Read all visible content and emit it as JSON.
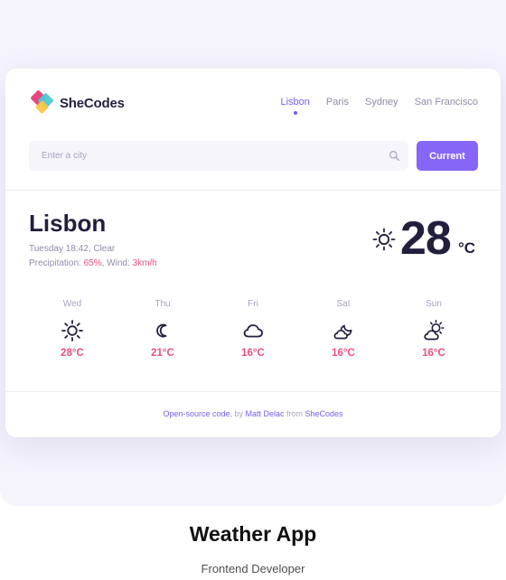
{
  "brand": {
    "name": "SheCodes"
  },
  "nav": {
    "items": [
      {
        "label": "Lisbon",
        "active": true
      },
      {
        "label": "Paris",
        "active": false
      },
      {
        "label": "Sydney",
        "active": false
      },
      {
        "label": "San Francisco",
        "active": false
      }
    ]
  },
  "search": {
    "placeholder": "Enter a city",
    "value": "",
    "icon": "search-icon",
    "button_label": "Current"
  },
  "current": {
    "city": "Lisbon",
    "day_time": "Tuesday 18:42",
    "condition": "Clear",
    "precipitation_label": "Precipitation:",
    "precipitation": "65%",
    "wind_label": "Wind:",
    "wind": "3km/h",
    "temperature": "28",
    "unit": "°C",
    "icon": "sun-icon"
  },
  "forecast": [
    {
      "day": "Wed",
      "temp": "28°C",
      "icon": "sun-icon"
    },
    {
      "day": "Thu",
      "temp": "21°C",
      "icon": "moon-icon"
    },
    {
      "day": "Fri",
      "temp": "16°C",
      "icon": "cloud-icon"
    },
    {
      "day": "Sat",
      "temp": "16°C",
      "icon": "cloud-moon-icon"
    },
    {
      "day": "Sun",
      "temp": "16°C",
      "icon": "cloud-sun-icon"
    }
  ],
  "footer": {
    "source_link": "Open-source code",
    "by_text": ", by ",
    "author_link": "Matt Delac",
    "from_text": " from ",
    "org_link": "SheCodes"
  },
  "caption": {
    "title": "Weather App",
    "subtitle": "Frontend Developer"
  },
  "colors": {
    "accent": "#8566f6",
    "highlight": "#ec4e84",
    "text_dark": "#221f3d",
    "text_muted": "#8f8ba8"
  }
}
